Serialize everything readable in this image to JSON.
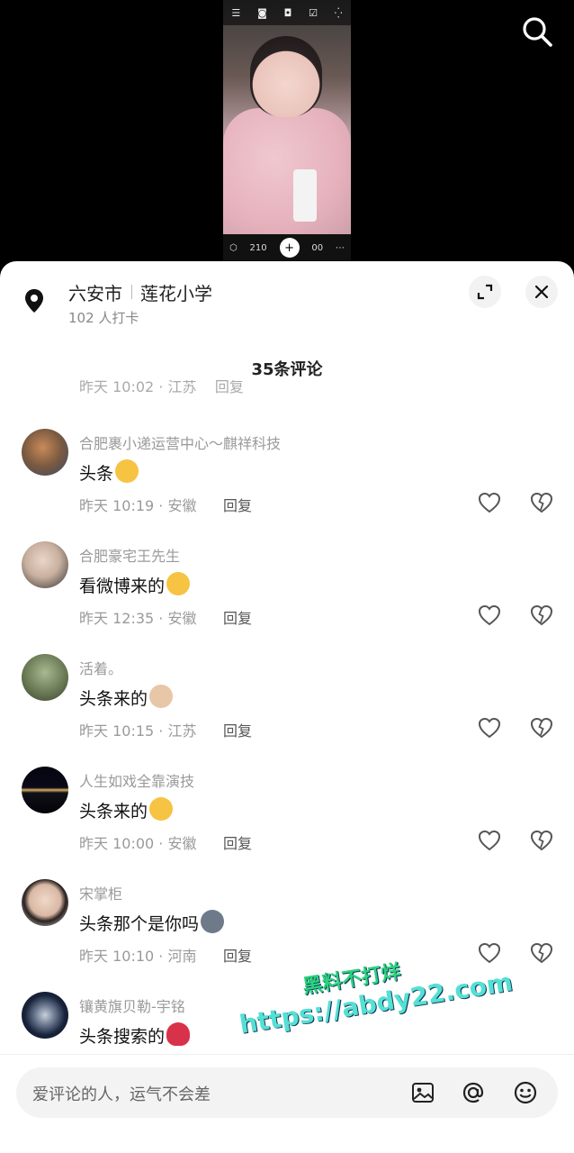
{
  "video": {
    "cam_counter_left": "210",
    "cam_counter_right": "00"
  },
  "location": {
    "city": "六安市",
    "school": "莲花小学",
    "checkins": "102 人打卡"
  },
  "comments_title": "35条评论",
  "partial_comment": {
    "meta": "昨天 10:02 · 江苏",
    "reply": "回复"
  },
  "comments": [
    {
      "name": "合肥裹小递运营中心～麒祥科技",
      "text": "头条",
      "meta": "昨天 10:19 · 安徽",
      "reply": "回复",
      "emoji": "grinning-sweat-emoji",
      "emoji_color": "#f6c343"
    },
    {
      "name": "合肥豪宅王先生",
      "text": "看微博来的",
      "meta": "昨天 12:35 · 安徽",
      "reply": "回复",
      "emoji": "loudly-crying-emoji",
      "emoji_color": "#f6c343"
    },
    {
      "name": "活着。",
      "text": "头条来的",
      "meta": "昨天 10:15 · 江苏",
      "reply": "回复",
      "emoji": "cat-face-emoji",
      "emoji_color": "#e8c6a8"
    },
    {
      "name": "人生如戏全靠演技",
      "text": "头条来的",
      "meta": "昨天 10:00 · 安徽",
      "reply": "回复",
      "emoji": "loudly-crying-emoji",
      "emoji_color": "#f6c343"
    },
    {
      "name": "宋掌柜",
      "text": "头条那个是你吗",
      "meta": "昨天 10:10 · 河南",
      "reply": "回复",
      "emoji": "husky-face-emoji",
      "emoji_color": "#6e7a8a"
    },
    {
      "name": "镶黄旗贝勒-宇铭",
      "text": "头条搜索的",
      "meta": "",
      "reply": "",
      "emoji": "rose-emoji",
      "emoji_color": "#d8324a"
    }
  ],
  "input": {
    "placeholder": "爱评论的人，运气不会差"
  },
  "watermark": {
    "line1": "黑料不打烊",
    "line2": "https://abdy22.com"
  }
}
